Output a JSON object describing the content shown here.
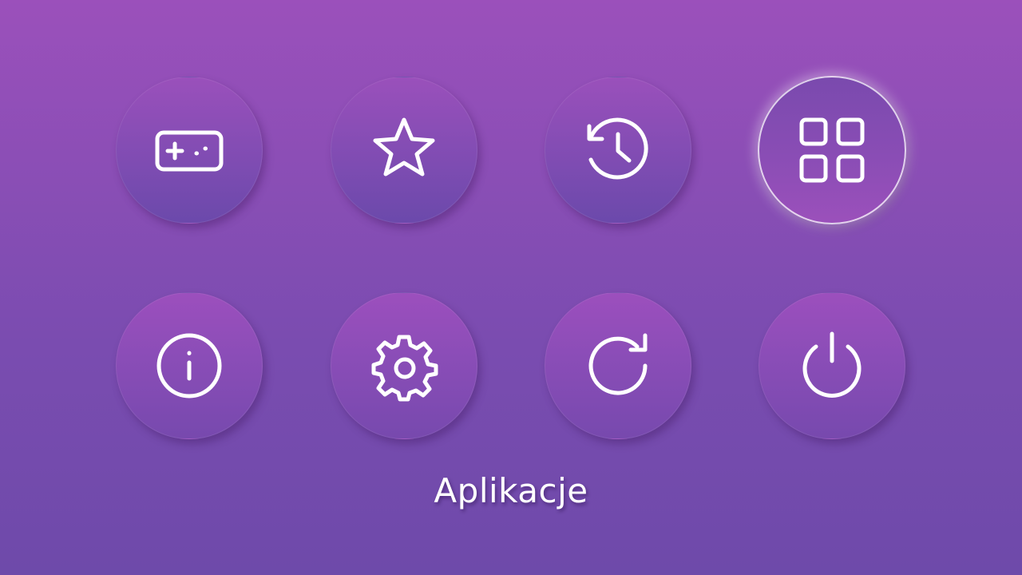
{
  "menu": {
    "items": [
      {
        "id": "games",
        "icon": "gamepad-icon",
        "selected": false
      },
      {
        "id": "favorites",
        "icon": "star-icon",
        "selected": false
      },
      {
        "id": "history",
        "icon": "history-icon",
        "selected": false
      },
      {
        "id": "apps",
        "icon": "apps-grid-icon",
        "selected": true
      },
      {
        "id": "info",
        "icon": "info-icon",
        "selected": false
      },
      {
        "id": "settings",
        "icon": "gear-icon",
        "selected": false
      },
      {
        "id": "restart",
        "icon": "refresh-icon",
        "selected": false
      },
      {
        "id": "power",
        "icon": "power-icon",
        "selected": false
      }
    ],
    "selected_label": "Aplikacje"
  },
  "colors": {
    "background_top": "#9b50bb",
    "background_bottom": "#6e4aaa",
    "icon": "#ffffff",
    "selected_ring": "#ffffff"
  }
}
